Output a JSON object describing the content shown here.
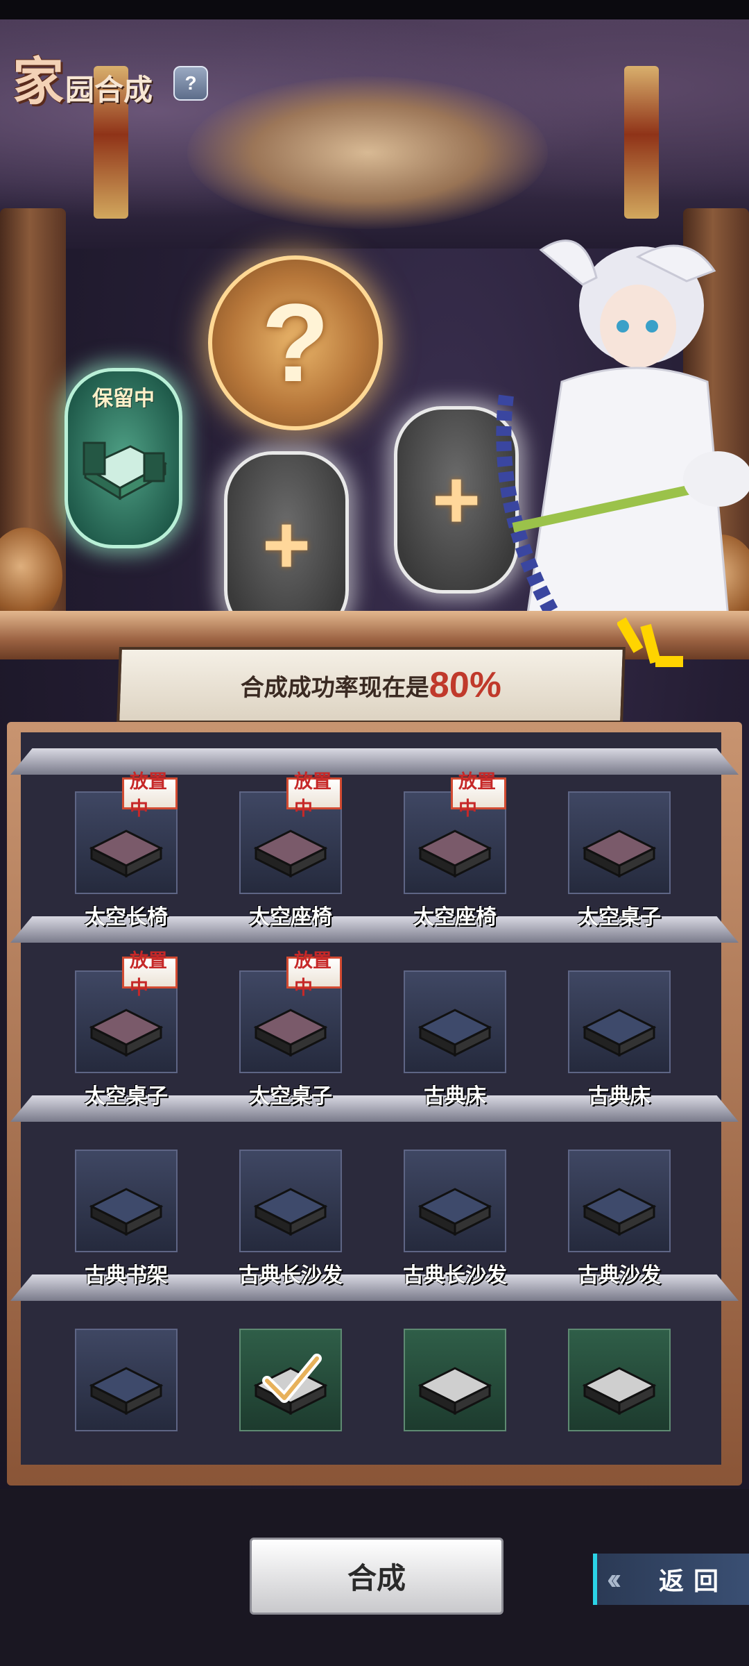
{
  "header": {
    "title_big": "家",
    "title_rest": "园合成",
    "help_label": "?"
  },
  "synthesis": {
    "result_symbol": "?",
    "slot_reserved_label": "保留中",
    "add_symbol": "+",
    "success_text": "合成成功率现在是",
    "success_rate": "80%"
  },
  "inventory": {
    "placed_tag": "放置中",
    "items": [
      {
        "name": "太空长椅",
        "placed": true,
        "kind": "space",
        "selected": false
      },
      {
        "name": "太空座椅",
        "placed": true,
        "kind": "space",
        "selected": false
      },
      {
        "name": "太空座椅",
        "placed": true,
        "kind": "space",
        "selected": false
      },
      {
        "name": "太空桌子",
        "placed": false,
        "kind": "space",
        "selected": false
      },
      {
        "name": "太空桌子",
        "placed": true,
        "kind": "space",
        "selected": false
      },
      {
        "name": "太空桌子",
        "placed": true,
        "kind": "space",
        "selected": false
      },
      {
        "name": "古典床",
        "placed": false,
        "kind": "classic",
        "selected": false
      },
      {
        "name": "古典床",
        "placed": false,
        "kind": "classic",
        "selected": false
      },
      {
        "name": "古典书架",
        "placed": false,
        "kind": "classic",
        "selected": false
      },
      {
        "name": "古典长沙发",
        "placed": false,
        "kind": "classic",
        "selected": false
      },
      {
        "name": "古典长沙发",
        "placed": false,
        "kind": "classic",
        "selected": false
      },
      {
        "name": "古典沙发",
        "placed": false,
        "kind": "classic",
        "selected": false
      },
      {
        "name": "",
        "placed": false,
        "kind": "classic",
        "selected": false
      },
      {
        "name": "",
        "placed": false,
        "kind": "green",
        "selected": true
      },
      {
        "name": "",
        "placed": false,
        "kind": "green",
        "selected": false
      },
      {
        "name": "",
        "placed": false,
        "kind": "green",
        "selected": false
      }
    ]
  },
  "footer": {
    "merge_label": "合成",
    "back_label": "返回"
  },
  "colors": {
    "accent_rate": "#c0392b",
    "placed_tag_text": "#c62828",
    "back_accent": "#2bd3e6"
  }
}
